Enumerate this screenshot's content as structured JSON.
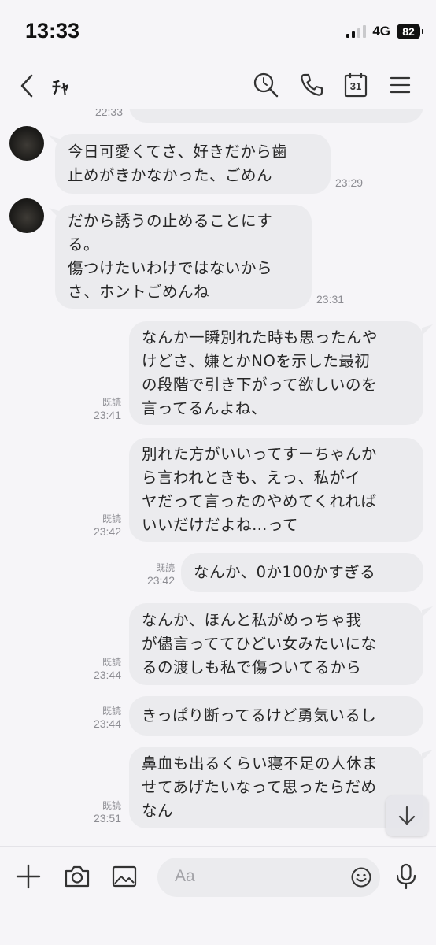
{
  "status_bar": {
    "time": "13:33",
    "network": "4G",
    "battery": "82"
  },
  "header": {
    "title": "ﾁｬ",
    "icons": [
      "back-icon",
      "search-icon",
      "phone-icon",
      "calendar-icon",
      "menu-icon"
    ],
    "calendar_day": "31"
  },
  "messages": [
    {
      "side": "right",
      "partial": true,
      "time": "22:33"
    },
    {
      "side": "left",
      "lines": [
        "今日可愛くてさ、好きだから歯",
        "止めがきかなかった、ごめん"
      ],
      "time": "23:29"
    },
    {
      "side": "left",
      "lines": [
        "だから誘うの止めることにす",
        "る。",
        "傷つけたいわけではないから",
        "さ、ホントごめんね"
      ],
      "time": "23:31"
    },
    {
      "side": "right",
      "lines": [
        "なんか一瞬別れた時も思ったんや",
        "けどさ、嫌とかNOを示した最初",
        "の段階で引き下がって欲しいのを",
        "言ってるんよね、"
      ],
      "read": "既読",
      "time": "23:41"
    },
    {
      "side": "right",
      "lines": [
        "別れた方がいいってすーちゃんか",
        "ら言われときも、えっ、私がイ",
        "ヤだって言ったのやめてくれれば",
        "いいだけだよね…って"
      ],
      "read": "既読",
      "time": "23:42"
    },
    {
      "side": "right",
      "lines": [
        "なんか、0か100かすぎる"
      ],
      "read": "既読",
      "time": "23:42"
    },
    {
      "side": "right",
      "lines": [
        "なんか、ほんと私がめっちゃ我",
        "が儘言っててひどい女みたいにな",
        "るの渡しも私で傷ついてるから"
      ],
      "read": "既読",
      "time": "23:44"
    },
    {
      "side": "right",
      "lines": [
        "きっぱり断ってるけど勇気いるし"
      ],
      "read": "既読",
      "time": "23:44"
    },
    {
      "side": "right",
      "lines": [
        "鼻血も出るくらい寝不足の人休ま",
        "せてあげたいなって思ったらだめ",
        "なん"
      ],
      "read": "既読",
      "time": "23:51"
    }
  ],
  "input_bar": {
    "placeholder": "Aa",
    "icons": [
      "plus-icon",
      "camera-icon",
      "image-icon",
      "emoji-icon",
      "microphone-icon"
    ]
  },
  "scroll_button": {
    "icon": "arrow-down-icon"
  },
  "colors": {
    "background": "#f6f5f8",
    "bubble": "#ebebee",
    "text": "#262626",
    "meta": "#8d8d93"
  }
}
